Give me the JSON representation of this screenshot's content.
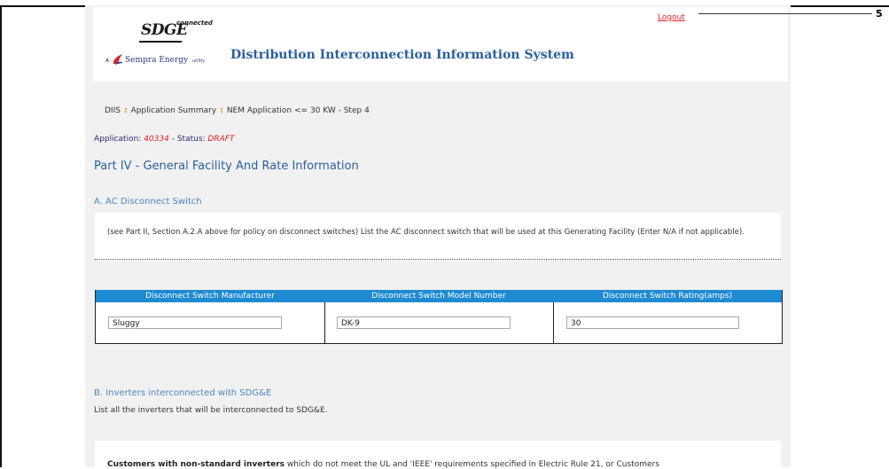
{
  "header": {
    "logo_sdge": "SDGE",
    "logo_connected": "connected",
    "logo_a": "A",
    "logo_sempra": "Sempra Energy",
    "logo_utility": "utility",
    "site_title": "Distribution Interconnection Information System",
    "logout_label": "Logout",
    "callout_number": "5"
  },
  "breadcrumb": {
    "items": [
      "DIIS",
      "Application Summary",
      "NEM Application <= 30 KW - Step 4"
    ],
    "separator": ":"
  },
  "application": {
    "label": "Application:",
    "number": "40334",
    "status_sep": "- Status:",
    "status": "DRAFT"
  },
  "part": {
    "title": "Part IV - General Facility And Rate Information"
  },
  "section_a": {
    "title": "A. AC Disconnect Switch",
    "note": "(see Part II, Section A.2.A above for policy on disconnect switches) List the AC disconnect switch that will be used at this Generating Facility (Enter N/A if not applicable).",
    "columns": [
      "Disconnect Switch Manufacturer",
      "Disconnect Switch Model Number",
      "Disconnect Switch Rating(amps)"
    ],
    "values": [
      "Sluggy",
      "DK-9",
      "30"
    ]
  },
  "section_b": {
    "title": "B. Inverters interconnected with SDG&E",
    "desc": "List all the inverters that will be interconnected to SDG&E.",
    "note_bold": "Customers with non-standard inverters",
    "note_rest": " which do not meet the UL and 'IEEE' requirements specified in Electric Rule 21, or Customers"
  },
  "colors": {
    "accent": "#2b5f9e",
    "table_header": "#1e8ad2",
    "status_red": "#e02020",
    "breadcrumb_sep": "#e07000"
  }
}
